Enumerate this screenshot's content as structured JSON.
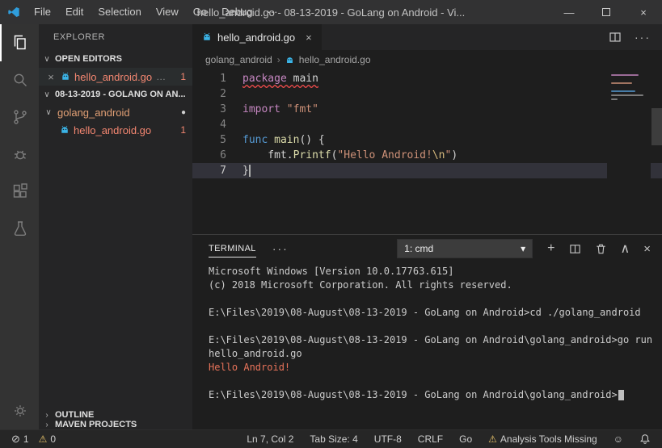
{
  "colors": {
    "keyword_purple": "#c586c0",
    "keyword_blue": "#569cd6",
    "function_yellow": "#dcdcaa",
    "string_orange": "#ce9178",
    "escape_gold": "#d7ba7d",
    "error_file_label": "#f48771",
    "squiggle_red": "#f14c4c",
    "terminal_accent": "#e8735a",
    "activity_bar_bg": "#333333",
    "sidebar_bg": "#252526",
    "editor_bg": "#1e1e1e"
  },
  "title_bar": {
    "menus": [
      "File",
      "Edit",
      "Selection",
      "View",
      "Go",
      "Debug",
      "···"
    ],
    "title": "hello_android.go - 08-13-2019 - GoLang on Android - Vi...",
    "minimize": "—",
    "close": "×"
  },
  "sidebar": {
    "title": "EXPLORER",
    "open_editors": {
      "header": "OPEN EDITORS",
      "chevron": "∨",
      "item": {
        "close": "×",
        "name": "hello_android.go",
        "description": "…",
        "badge": "1"
      }
    },
    "workspace": {
      "header": "08-13-2019 - GOLANG ON AN...",
      "chevron": "∨",
      "folder": {
        "chevron": "∨",
        "name": "golang_android",
        "indicator": "●"
      },
      "file": {
        "name": "hello_android.go",
        "badge": "1"
      }
    },
    "outline": {
      "chevron": "›",
      "label": "OUTLINE"
    },
    "maven": {
      "chevron": "›",
      "label": "MAVEN PROJECTS"
    }
  },
  "editor": {
    "tab": {
      "label": "hello_android.go",
      "close": "×"
    },
    "actions_more": "···",
    "breadcrumb": {
      "folder": "golang_android",
      "separator": "›",
      "file": "hello_android.go"
    },
    "code": {
      "l1": {
        "num": "1",
        "kw": "package ",
        "id": "main"
      },
      "l2": {
        "num": "2"
      },
      "l3": {
        "num": "3",
        "kw": "import ",
        "str": "\"fmt\""
      },
      "l4": {
        "num": "4"
      },
      "l5": {
        "num": "5",
        "kw": "func ",
        "fn": "main",
        "rest": "() {"
      },
      "l6": {
        "num": "6",
        "pre": "    fmt.",
        "fn": "Printf",
        "p1": "(",
        "str": "\"Hello Android!",
        "esc": "\\n",
        "q": "\"",
        "p2": ")"
      },
      "l7": {
        "num": "7",
        "brace": "}"
      }
    }
  },
  "panel": {
    "tab": "TERMINAL",
    "more": "···",
    "dropdown": "1: cmd",
    "caret": "▾",
    "plus": "+",
    "close": "×",
    "chevron_up": "∧"
  },
  "terminal": {
    "lines": [
      "Microsoft Windows [Version 10.0.17763.615]",
      "(c) 2018 Microsoft Corporation. All rights reserved.",
      "",
      "E:\\Files\\2019\\08-August\\08-13-2019 - GoLang on Android>cd ./golang_android",
      "",
      "E:\\Files\\2019\\08-August\\08-13-2019 - GoLang on Android\\golang_android>go run",
      "hello_android.go",
      "Hello Android!",
      "",
      "E:\\Files\\2019\\08-August\\08-13-2019 - GoLang on Android\\golang_android>"
    ]
  },
  "status_bar": {
    "error_glyph": "⊘",
    "errors": "1",
    "warning_glyph": "⚠",
    "warnings": "0",
    "cursor": "Ln 7, Col 2",
    "tab_size": "Tab Size: 4",
    "encoding": "UTF-8",
    "eol": "CRLF",
    "language": "Go",
    "analysis_glyph": "⚠",
    "analysis": "Analysis Tools Missing",
    "smiley": "☺"
  }
}
